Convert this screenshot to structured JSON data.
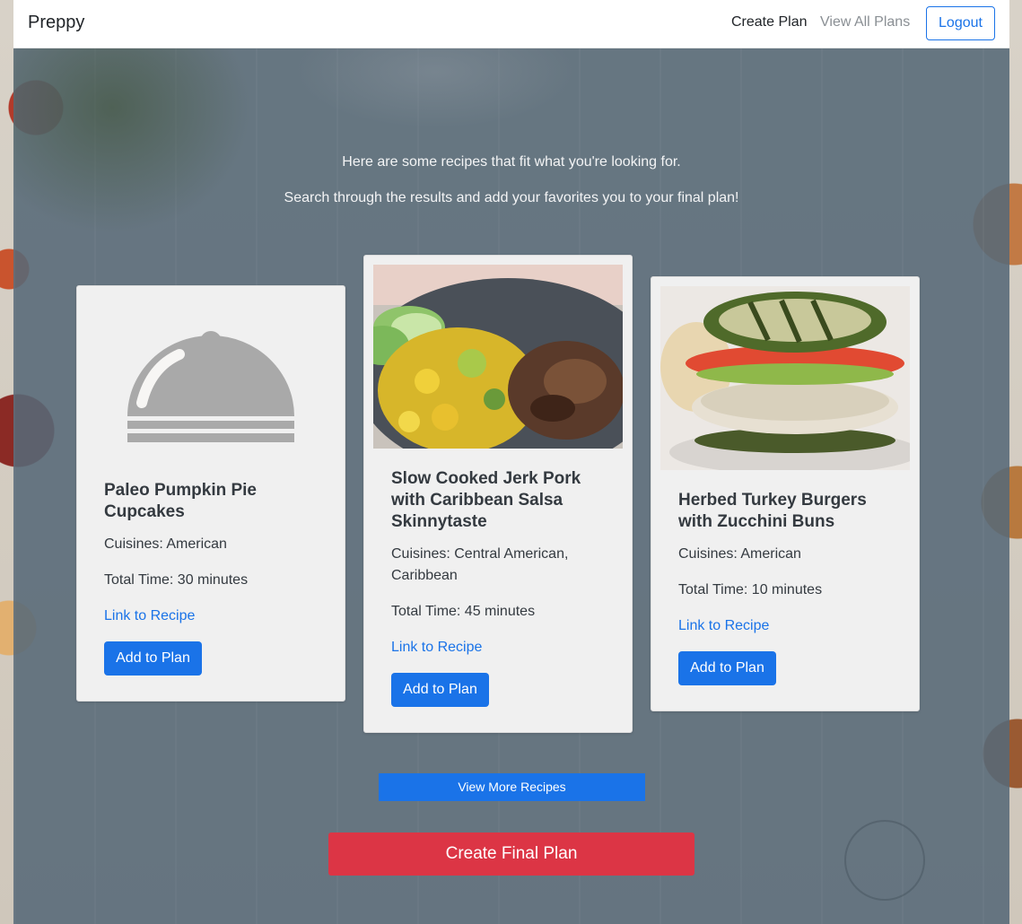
{
  "navbar": {
    "brand": "Preppy",
    "create_plan": "Create Plan",
    "view_all_plans": "View All Plans",
    "logout": "Logout"
  },
  "intro": {
    "line1": "Here are some recipes that fit what you're looking for.",
    "line2": "Search through the results and add your favorites you to your final plan!"
  },
  "recipes": [
    {
      "title": "Paleo Pumpkin Pie Cupcakes",
      "cuisines": "Cuisines: American",
      "total_time": "Total Time: 30 minutes",
      "link": "Link to Recipe",
      "add_label": "Add to Plan",
      "image": "cloche-placeholder-icon"
    },
    {
      "title": "Slow Cooked Jerk Pork with Caribbean Salsa Skinnytaste",
      "cuisines": "Cuisines: Central American, Caribbean",
      "total_time": "Total Time: 45 minutes",
      "link": "Link to Recipe",
      "add_label": "Add to Plan",
      "image": "jerk-pork-photo"
    },
    {
      "title": "Herbed Turkey Burgers with Zucchini Buns",
      "cuisines": "Cuisines: American",
      "total_time": "Total Time: 10 minutes",
      "link": "Link to Recipe",
      "add_label": "Add to Plan",
      "image": "turkey-burger-photo"
    }
  ],
  "actions": {
    "view_more": "View More Recipes",
    "create_final": "Create Final Plan"
  },
  "colors": {
    "primary": "#1a73e8",
    "danger": "#dc3545",
    "overlay": "#566978"
  }
}
